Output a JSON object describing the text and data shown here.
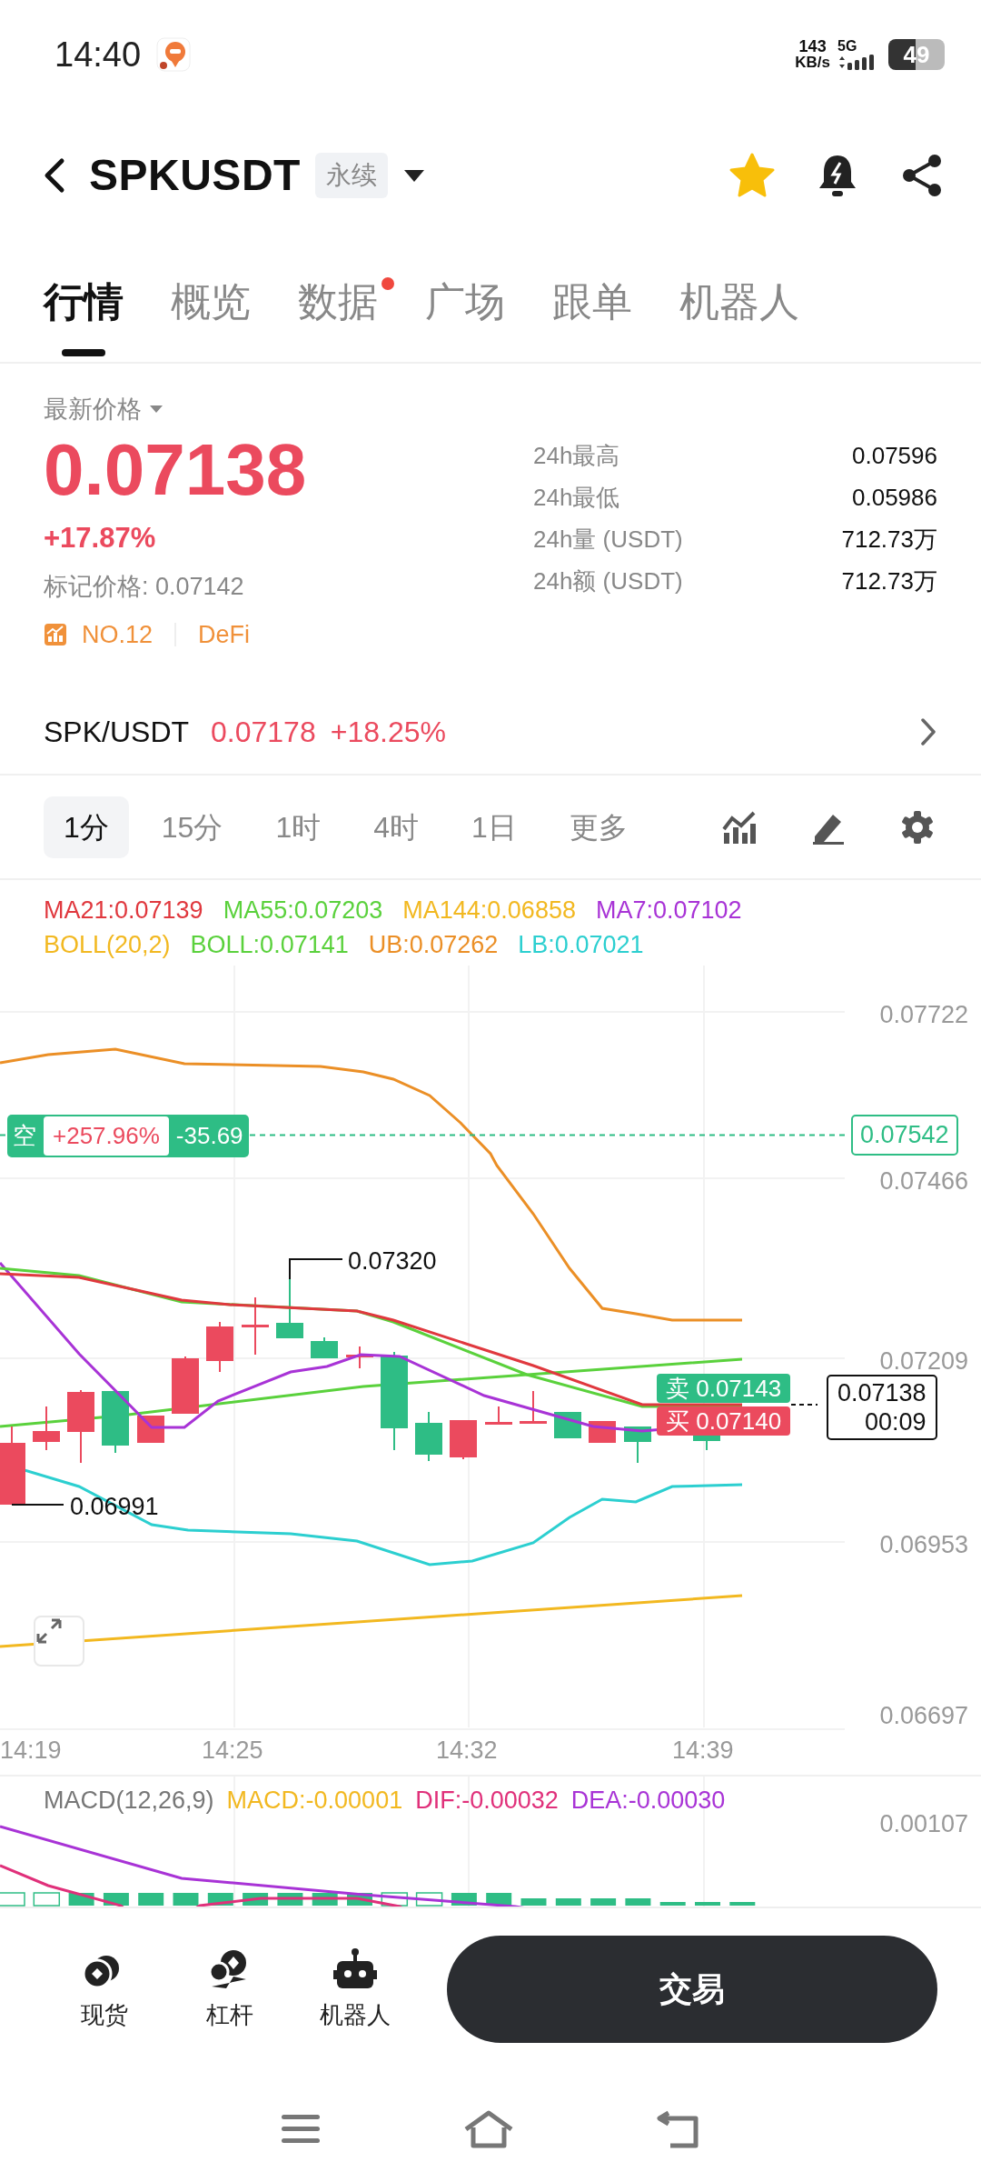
{
  "status_bar": {
    "time": "14:40",
    "net_speed_value": "143",
    "net_speed_unit": "KB/s",
    "network": "5G",
    "battery": "49"
  },
  "header": {
    "symbol": "SPKUSDT",
    "contract_type": "永续",
    "favorite": true
  },
  "tabs": [
    {
      "label": "行情",
      "selected": true,
      "dot": false
    },
    {
      "label": "概览",
      "selected": false,
      "dot": false
    },
    {
      "label": "数据",
      "selected": false,
      "dot": true
    },
    {
      "label": "广场",
      "selected": false,
      "dot": false
    },
    {
      "label": "跟单",
      "selected": false,
      "dot": false
    },
    {
      "label": "机器人",
      "selected": false,
      "dot": false
    }
  ],
  "price": {
    "label": "最新价格",
    "last": "0.07138",
    "change": "+17.87%",
    "mark": "标记价格: 0.07142",
    "rank": "NO.12",
    "sector": "DeFi"
  },
  "stats": [
    {
      "label": "24h最高",
      "value": "0.07596"
    },
    {
      "label": "24h最低",
      "value": "0.05986"
    },
    {
      "label": "24h量 (USDT)",
      "value": "712.73万"
    },
    {
      "label": "24h额 (USDT)",
      "value": "712.73万"
    }
  ],
  "spot": {
    "pair": "SPK/USDT",
    "price": "0.07178",
    "change": "+18.25%"
  },
  "intervals": [
    {
      "label": "1分",
      "selected": true
    },
    {
      "label": "15分",
      "selected": false
    },
    {
      "label": "1时",
      "selected": false
    },
    {
      "label": "4时",
      "selected": false
    },
    {
      "label": "1日",
      "selected": false
    },
    {
      "label": "更多",
      "selected": false
    }
  ],
  "indicator_rows": [
    [
      {
        "text": "MA21:0.07139",
        "color": "#e0383e"
      },
      {
        "text": "MA55:0.07203",
        "color": "#5ad13c"
      },
      {
        "text": "MA144:0.06858",
        "color": "#f2b820"
      },
      {
        "text": "MA7:0.07102",
        "color": "#a833d6"
      }
    ],
    [
      {
        "text": "BOLL(20,2)",
        "color": "#f2b820"
      },
      {
        "text": "BOLL:0.07141",
        "color": "#5ad13c"
      },
      {
        "text": "UB:0.07262",
        "color": "#eb8f26"
      },
      {
        "text": "LB:0.07021",
        "color": "#2ccfd0"
      }
    ]
  ],
  "chart": {
    "y_ticks": [
      "0.07722",
      "0.07466",
      "0.07209",
      "0.06953",
      "0.06697"
    ],
    "x_labels": [
      "14:19",
      "14:25",
      "14:32",
      "14:39"
    ],
    "position": {
      "side": "空",
      "pnl_pct": "+257.96%",
      "pnl": "-35.69",
      "price": "0.07542"
    },
    "high_marker": "0.07320",
    "low_marker": "0.06991",
    "ask": {
      "label": "卖",
      "price": "0.07143"
    },
    "bid": {
      "label": "买",
      "price": "0.07140"
    },
    "last": {
      "price": "0.07138",
      "countdown": "00:09"
    }
  },
  "macd": {
    "legend": [
      {
        "text": "MACD(12,26,9)",
        "color": "#777777"
      },
      {
        "text": "MACD:-0.00001",
        "color": "#f2b820"
      },
      {
        "text": "DIF:-0.00032",
        "color": "#e0307a"
      },
      {
        "text": "DEA:-0.00030",
        "color": "#a833d6"
      }
    ],
    "y_tick": "0.00107"
  },
  "bottom_nav": [
    {
      "label": "现货",
      "kind": "spot"
    },
    {
      "label": "杠杆",
      "kind": "margin"
    },
    {
      "label": "机器人",
      "kind": "robot"
    }
  ],
  "trade_button": "交易"
}
